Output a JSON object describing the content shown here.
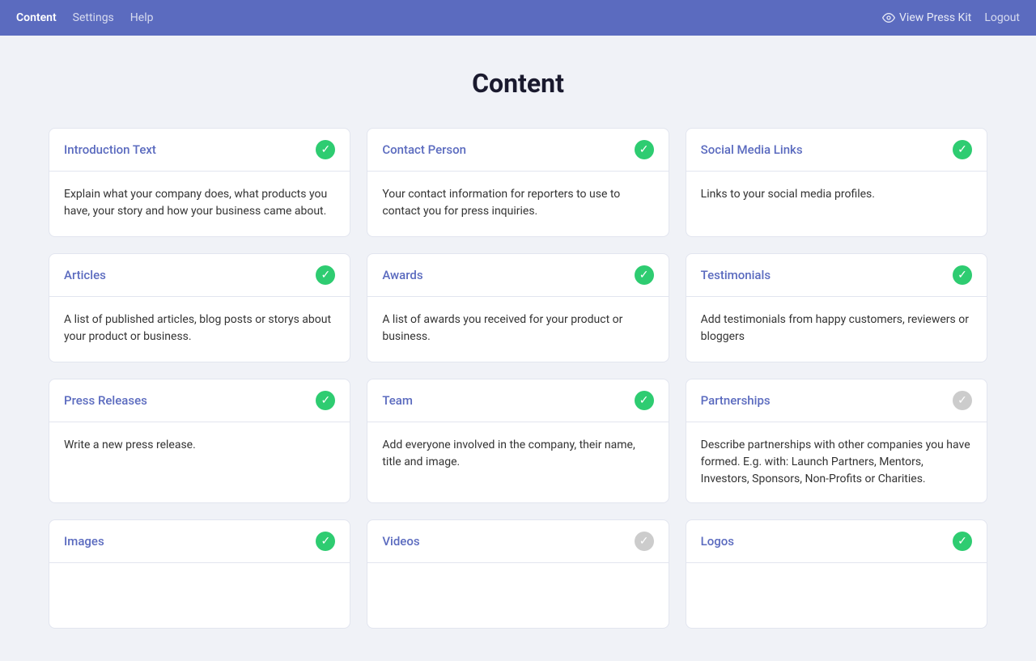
{
  "nav": {
    "brand": "Content",
    "items": [
      {
        "label": "Settings",
        "active": false
      },
      {
        "label": "Help",
        "active": false
      }
    ],
    "right": [
      {
        "label": "View Press Kit",
        "icon": "eye-icon"
      },
      {
        "label": "Logout"
      }
    ]
  },
  "page": {
    "title": "Content"
  },
  "cards": [
    {
      "id": "introduction-text",
      "title": "Introduction Text",
      "status": "green",
      "body": "Explain what your company does, what products you have, your story and how your business came about."
    },
    {
      "id": "contact-person",
      "title": "Contact Person",
      "status": "green",
      "body": "Your contact information for reporters to use to contact you for press inquiries."
    },
    {
      "id": "social-media-links",
      "title": "Social Media Links",
      "status": "green",
      "body": "Links to your social media profiles."
    },
    {
      "id": "articles",
      "title": "Articles",
      "status": "green",
      "body": "A list of published articles, blog posts or storys about your product or business."
    },
    {
      "id": "awards",
      "title": "Awards",
      "status": "green",
      "body": "A list of awards you received for your product or business."
    },
    {
      "id": "testimonials",
      "title": "Testimonials",
      "status": "green",
      "body": "Add testimonials from happy customers, reviewers or bloggers"
    },
    {
      "id": "press-releases",
      "title": "Press Releases",
      "status": "green",
      "body": "Write a new press release."
    },
    {
      "id": "team",
      "title": "Team",
      "status": "green",
      "body": "Add everyone involved in the company, their name, title and image."
    },
    {
      "id": "partnerships",
      "title": "Partnerships",
      "status": "gray",
      "body": "Describe partnerships with other companies you have formed. E.g. with: Launch Partners, Mentors, Investors, Sponsors, Non-Profits or Charities."
    },
    {
      "id": "images",
      "title": "Images",
      "status": "green",
      "body": ""
    },
    {
      "id": "videos",
      "title": "Videos",
      "status": "gray",
      "body": ""
    },
    {
      "id": "logos",
      "title": "Logos",
      "status": "green",
      "body": ""
    }
  ]
}
